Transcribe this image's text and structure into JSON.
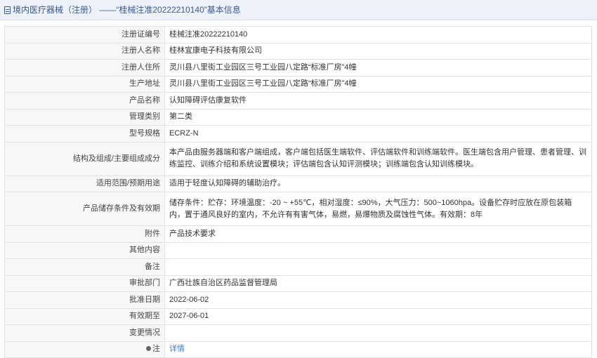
{
  "header": {
    "title": "境内医疗器械（注册） ——“桂械注准20222210140”基本信息"
  },
  "rows": [
    {
      "label": "注册证编号",
      "value": "桂械注准20222210140"
    },
    {
      "label": "注册人名称",
      "value": "桂林宜康电子科技有限公司"
    },
    {
      "label": "注册人住所",
      "value": "灵川县八里街工业园区三号工业园八定路“标准厂房”4幢"
    },
    {
      "label": "生产地址",
      "value": "灵川县八里街工业园区三号工业园八定路“标准厂房”4幢"
    },
    {
      "label": "产品名称",
      "value": "认知障碍评估康复软件"
    },
    {
      "label": "管理类别",
      "value": "第二类"
    },
    {
      "label": "型号规格",
      "value": "ECRZ-N"
    },
    {
      "label": "结构及组成/主要组成成分",
      "value": "本产品由服务器端和客户端组成，客户端包括医生端软件、评估端软件和训练端软件。医生端包含用户管理、患者管理、训练监控、训练介绍和系统设置模块；评估端包含认知评测模块；训练端包含认知训练模块。"
    },
    {
      "label": "适用范围/预期用途",
      "value": "适用于轻度认知障碍的辅助治疗。"
    },
    {
      "label": "产品储存条件及有效期",
      "value": "储存条件：贮存：环境温度：-20 ~ +55℃，相对湿度：≤90%，大气压力：500~1060hpa。设备贮存时应放在原包装箱内，置于通风良好的室内，不允许有有害气体，易燃，易爆物质及腐蚀性气体。有效期：8年"
    },
    {
      "label": "附件",
      "value": "产品技术要求"
    },
    {
      "label": "其他内容",
      "value": ""
    },
    {
      "label": "备注",
      "value": ""
    },
    {
      "label": "审批部门",
      "value": "广西壮族自治区药品监督管理局"
    },
    {
      "label": "批准日期",
      "value": "2022-06-02"
    },
    {
      "label": "有效期至",
      "value": "2027-06-01"
    },
    {
      "label": "变更情况",
      "value": ""
    },
    {
      "label": "注",
      "value": "详情"
    }
  ],
  "icons": {
    "title": "document-icon",
    "note": "note-icon"
  },
  "colors": {
    "link": "#2f7fd8",
    "title_text": "#3c5a8a",
    "label_bg": "#f7f7f7",
    "border": "#dfe3e8"
  }
}
